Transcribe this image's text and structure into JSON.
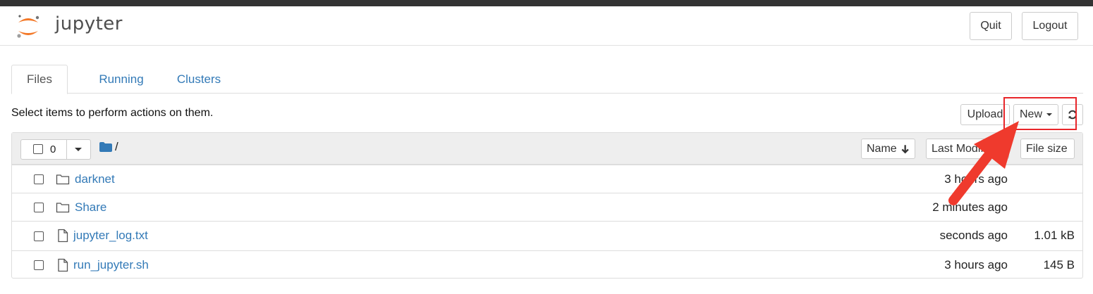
{
  "header": {
    "logo_text": "jupyter",
    "quit_label": "Quit",
    "logout_label": "Logout"
  },
  "tabs": [
    {
      "label": "Files",
      "active": true
    },
    {
      "label": "Running",
      "active": false
    },
    {
      "label": "Clusters",
      "active": false
    }
  ],
  "toolbar": {
    "hint": "Select items to perform actions on them.",
    "upload_label": "Upload",
    "new_label": "New",
    "refresh_icon": "refresh-icon"
  },
  "list": {
    "selected_count": "0",
    "path": "/",
    "columns": {
      "name": "Name",
      "last_modified": "Last Modified",
      "file_size": "File size"
    },
    "items": [
      {
        "type": "folder",
        "name": "darknet",
        "modified": "3 hours ago",
        "size": ""
      },
      {
        "type": "folder",
        "name": "Share",
        "modified": "2 minutes ago",
        "size": ""
      },
      {
        "type": "file",
        "name": "jupyter_log.txt",
        "modified": "seconds ago",
        "size": "1.01 kB"
      },
      {
        "type": "file",
        "name": "run_jupyter.sh",
        "modified": "3 hours ago",
        "size": "145 B"
      }
    ]
  },
  "colors": {
    "link": "#337ab7",
    "logo_orange": "#f37726",
    "annotation_red": "#e8262a"
  }
}
